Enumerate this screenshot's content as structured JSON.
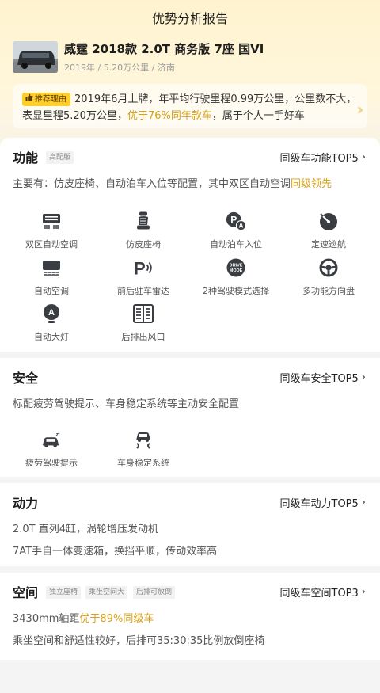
{
  "header": {
    "title": "优势分析报告"
  },
  "car": {
    "title": "威霆 2018款 2.0T 商务版 7座 国VI",
    "meta": "2019年 / 5.20万公里 / 济南"
  },
  "reason": {
    "badge": "推荐理由",
    "text_before": "2019年6月上牌，年平均行驶里程0.99万公里，公里数不大，表显里程5.20万公里，",
    "highlight": "优于76%同年款车",
    "text_after": "，属于个人一手好车"
  },
  "colors": {
    "highlight": "#d9a11a",
    "badge": "#ffce2b"
  },
  "function": {
    "title": "功能",
    "tag": "高配版",
    "top_link": "同级车功能TOP5",
    "summary_before": "主要有：仿皮座椅、自动泊车入位等配置，其中双区自动空调",
    "summary_highlight": "同级领先",
    "features": [
      {
        "icon": "dual-zone-ac-icon",
        "label": "双区自动空调"
      },
      {
        "icon": "leather-seat-icon",
        "label": "仿皮座椅"
      },
      {
        "icon": "auto-parking-icon",
        "label": "自动泊车入位"
      },
      {
        "icon": "cruise-control-icon",
        "label": "定速巡航"
      },
      {
        "icon": "auto-ac-icon",
        "label": "自动空调"
      },
      {
        "icon": "parking-radar-icon",
        "label": "前后驻车雷达"
      },
      {
        "icon": "drive-mode-icon",
        "label": "2种驾驶模式选择",
        "icon_text": "DRIVE\nMODE"
      },
      {
        "icon": "steering-wheel-icon",
        "label": "多功能方向盘"
      },
      {
        "icon": "auto-headlight-icon",
        "label": "自动大灯"
      },
      {
        "icon": "rear-vent-icon",
        "label": "后排出风口"
      }
    ]
  },
  "safety": {
    "title": "安全",
    "top_link": "同级车安全TOP5",
    "summary": "标配疲劳驾驶提示、车身稳定系统等主动安全配置",
    "features": [
      {
        "icon": "fatigue-driving-icon",
        "label": "疲劳驾驶提示"
      },
      {
        "icon": "stability-control-icon",
        "label": "车身稳定系统"
      }
    ]
  },
  "power": {
    "title": "动力",
    "top_link": "同级车动力TOP5",
    "line1": "2.0T 直列4缸，涡轮增压发动机",
    "line2": "7AT手自一体变速箱，换挡平顺，传动效率高"
  },
  "space": {
    "title": "空间",
    "tags": [
      "独立座椅",
      "乘坐空间大",
      "后排可放倒"
    ],
    "top_link": "同级车空间TOP3",
    "line1_before": "3430mm轴距",
    "line1_highlight": "优于89%同级车",
    "line2": "乘坐空间和舒适性较好，后排可35:30:35比例放倒座椅"
  }
}
